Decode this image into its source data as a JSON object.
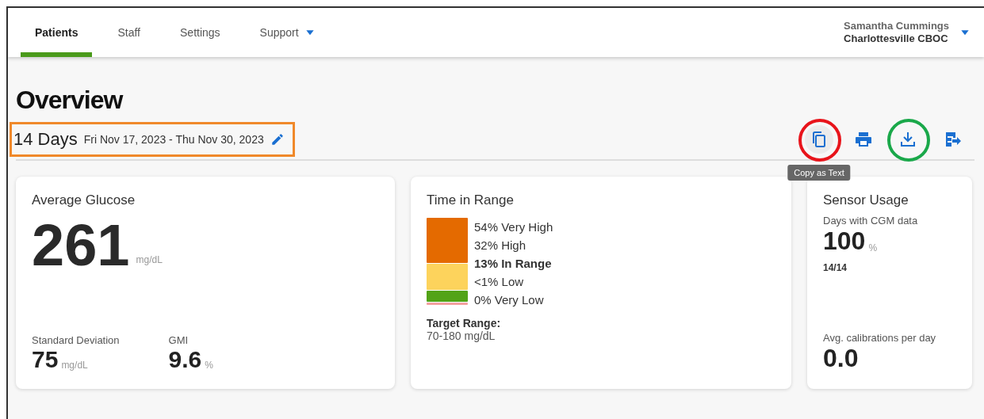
{
  "nav": {
    "tabs": [
      {
        "label": "Patients",
        "selected": true
      },
      {
        "label": "Staff",
        "selected": false
      },
      {
        "label": "Settings",
        "selected": false
      },
      {
        "label": "Support",
        "selected": false,
        "dropdown": true
      }
    ],
    "user": {
      "name": "Samantha Cummings",
      "location": "Charlottesville CBOC"
    }
  },
  "title": "Overview",
  "date_range": {
    "length": "14 Days",
    "dates": "Fri Nov 17, 2023 - Thu Nov 30, 2023",
    "color": "#f0892a"
  },
  "actions": [
    {
      "kind": "copy",
      "hovered": true,
      "color": "#e8141b"
    },
    {
      "kind": "print",
      "hovered": false
    },
    {
      "kind": "download",
      "hovered": false,
      "color": "#1aa84a"
    },
    {
      "kind": "export",
      "hovered": false
    }
  ],
  "tooltip": "Copy as Text",
  "average_glucose": {
    "title": "Average Glucose",
    "value": "261",
    "unit": "mg/dL",
    "stats": [
      {
        "label": "Standard Deviation",
        "value": "75",
        "unit": "mg/dL"
      },
      {
        "label": "GMI",
        "value": "9.6",
        "unit": "%"
      }
    ]
  },
  "time_in_range": {
    "title": "Time in Range",
    "segments": [
      {
        "color": "#e46a00"
      },
      {
        "color": "#fdd35c"
      },
      {
        "color": "#52a317"
      },
      {
        "color": "#f4a0a0"
      }
    ],
    "legend": [
      {
        "text": "54% Very High",
        "bold": false
      },
      {
        "text": "32% High",
        "bold": false
      },
      {
        "text": "13% In Range",
        "bold": true
      },
      {
        "text": "<1% Low",
        "bold": false
      },
      {
        "text": "0% Very Low",
        "bold": false
      }
    ],
    "target_label": "Target Range:",
    "target_value": "70-180 mg/dL"
  },
  "sensor_usage": {
    "title": "Sensor Usage",
    "days_label": "Days with CGM data",
    "days_value": "100",
    "days_unit": "%",
    "days_count": "14/14",
    "calibrations_label": "Avg. calibrations per day",
    "calibrations_value": "0.0"
  }
}
